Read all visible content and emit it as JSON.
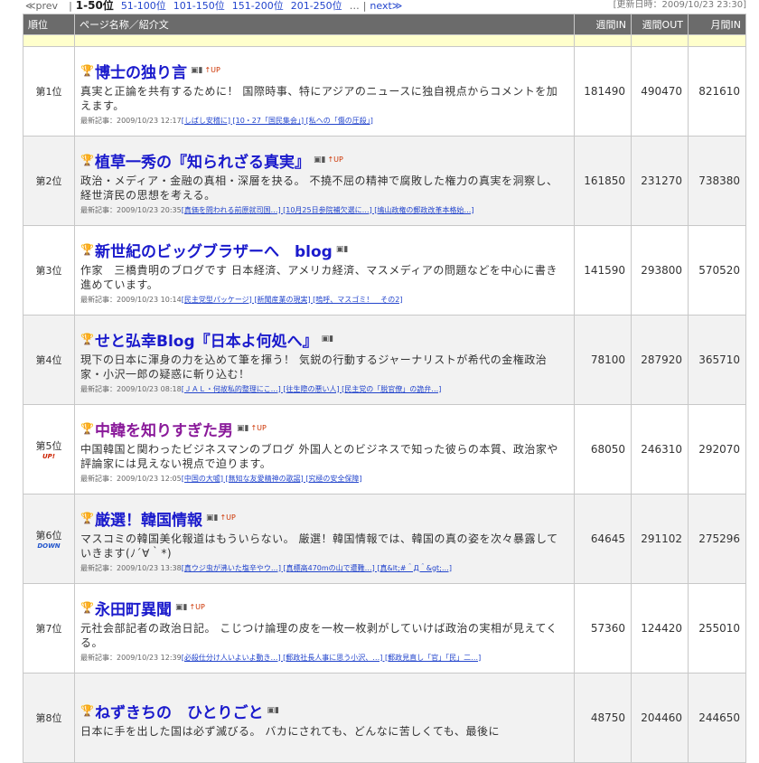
{
  "nav": {
    "prev": "≪prev",
    "sep": "|",
    "current": "1-50位",
    "pages": [
      "51-100位",
      "101-150位",
      "151-200位",
      "201-250位"
    ],
    "more": "…",
    "next": "next≫",
    "updated": "[更新日時：2009/10/23 23:30]"
  },
  "header": {
    "rank": "順位",
    "name": "ページ名称／紹介文",
    "weekly_in": "週間IN",
    "weekly_out": "週間OUT",
    "monthly_in": "月間IN"
  },
  "recent_label": "最新記事：",
  "rows": [
    {
      "rank": "第1位",
      "badge": "",
      "title": "博士の独り言",
      "has_up": true,
      "desc": "真実と正論を共有するために！ 国際時事、特にアジアのニュースに独自視点からコメントを加えます。",
      "recent_date": "2009/10/23 12:17",
      "articles": "[しばし安稽に] [10・27「国民集会」] [私への「傷の圧殺」]",
      "weekly_in": "181490",
      "weekly_out": "490470",
      "monthly_in": "821610"
    },
    {
      "rank": "第2位",
      "badge": "",
      "title": "植草一秀の『知られざる真実』",
      "has_up": true,
      "desc": "政治・メディア・金融の真相・深層を抉る。 不撓不屈の精神で腐敗した権力の真実を洞察し、経世済民の思想を考える。",
      "recent_date": "2009/10/23 20:35",
      "articles": "[真価を問われる前原就司国…] [10月25日参院補欠選に…] [鳩山政権の郵政改革本格始…]",
      "weekly_in": "161850",
      "weekly_out": "231270",
      "monthly_in": "738380"
    },
    {
      "rank": "第3位",
      "badge": "",
      "title": "新世紀のビッグブラザーへ　blog",
      "has_up": false,
      "desc": "作家　三橋貴明のブログです 日本経済、アメリカ経済、マスメディアの問題などを中心に書き進めています。",
      "recent_date": "2009/10/23 10:14",
      "articles": "[民主党型パッケージ] [新聞産業の現実] [嗚呼、マスゴミ！　その2]",
      "weekly_in": "141590",
      "weekly_out": "293800",
      "monthly_in": "570520"
    },
    {
      "rank": "第4位",
      "badge": "",
      "title": "せと弘幸Blog『日本よ何処へ』",
      "has_up": false,
      "desc": "現下の日本に渾身の力を込めて筆を揮う！ 気鋭の行動するジャーナリストが希代の金権政治家・小沢一郎の疑惑に斬り込む！",
      "recent_date": "2009/10/23 08:18",
      "articles": "[ＪＡＬ・何故私的整理にこ…] [往生際の悪い人] [民主党の「脱官僚」の詭弁…]",
      "weekly_in": "78100",
      "weekly_out": "287920",
      "monthly_in": "365710"
    },
    {
      "rank": "第5位",
      "badge": "UP!",
      "title": "中韓を知りすぎた男",
      "has_up": true,
      "desc": "中国韓国と関わったビジネスマンのブログ 外国人とのビジネスで知った彼らの本質、政治家や評論家には見えない視点で迫ります。",
      "recent_date": "2009/10/23 12:05",
      "articles": "[中国の大嘘] [無知な友愛精神の歌謡] [究極の安全保障]",
      "weekly_in": "68050",
      "weekly_out": "246310",
      "monthly_in": "292070"
    },
    {
      "rank": "第6位",
      "badge": "DOWN",
      "title": "厳選！韓国情報",
      "has_up": true,
      "desc": "マスコミの韓国美化報道はもういらない。 厳選！韓国情報では、韓国の真の姿を次々暴露していきます(ﾉ´∀｀*)",
      "recent_date": "2009/10/23 13:38",
      "articles": "[真ウジ虫が沸いた塩辛やウ…] [真標高470mの山で遭難…] [真&lt;#＾Д＾&gt;…]",
      "weekly_in": "64645",
      "weekly_out": "291102",
      "monthly_in": "275296"
    },
    {
      "rank": "第7位",
      "badge": "",
      "title": "永田町異聞",
      "has_up": true,
      "desc": "元社会部記者の政治日記。 こじつけ論理の皮を一枚一枚剥がしていけば政治の実相が見えてくる。",
      "recent_date": "2009/10/23 12:39",
      "articles": "[必殺仕分け人いよいよ動き…] [郵政社長人事に思う小沢、…] [郵政見直し「官」「民」二…]",
      "weekly_in": "57360",
      "weekly_out": "124420",
      "monthly_in": "255010"
    },
    {
      "rank": "第8位",
      "badge": "",
      "title": "ねずきちの　ひとりごと",
      "has_up": false,
      "desc": "日本に手を出した国は必ず滅びる。 バカにされても、どんなに苦しくても、最後に",
      "recent_date": "",
      "articles": "",
      "weekly_in": "48750",
      "weekly_out": "204460",
      "monthly_in": "244650"
    }
  ]
}
